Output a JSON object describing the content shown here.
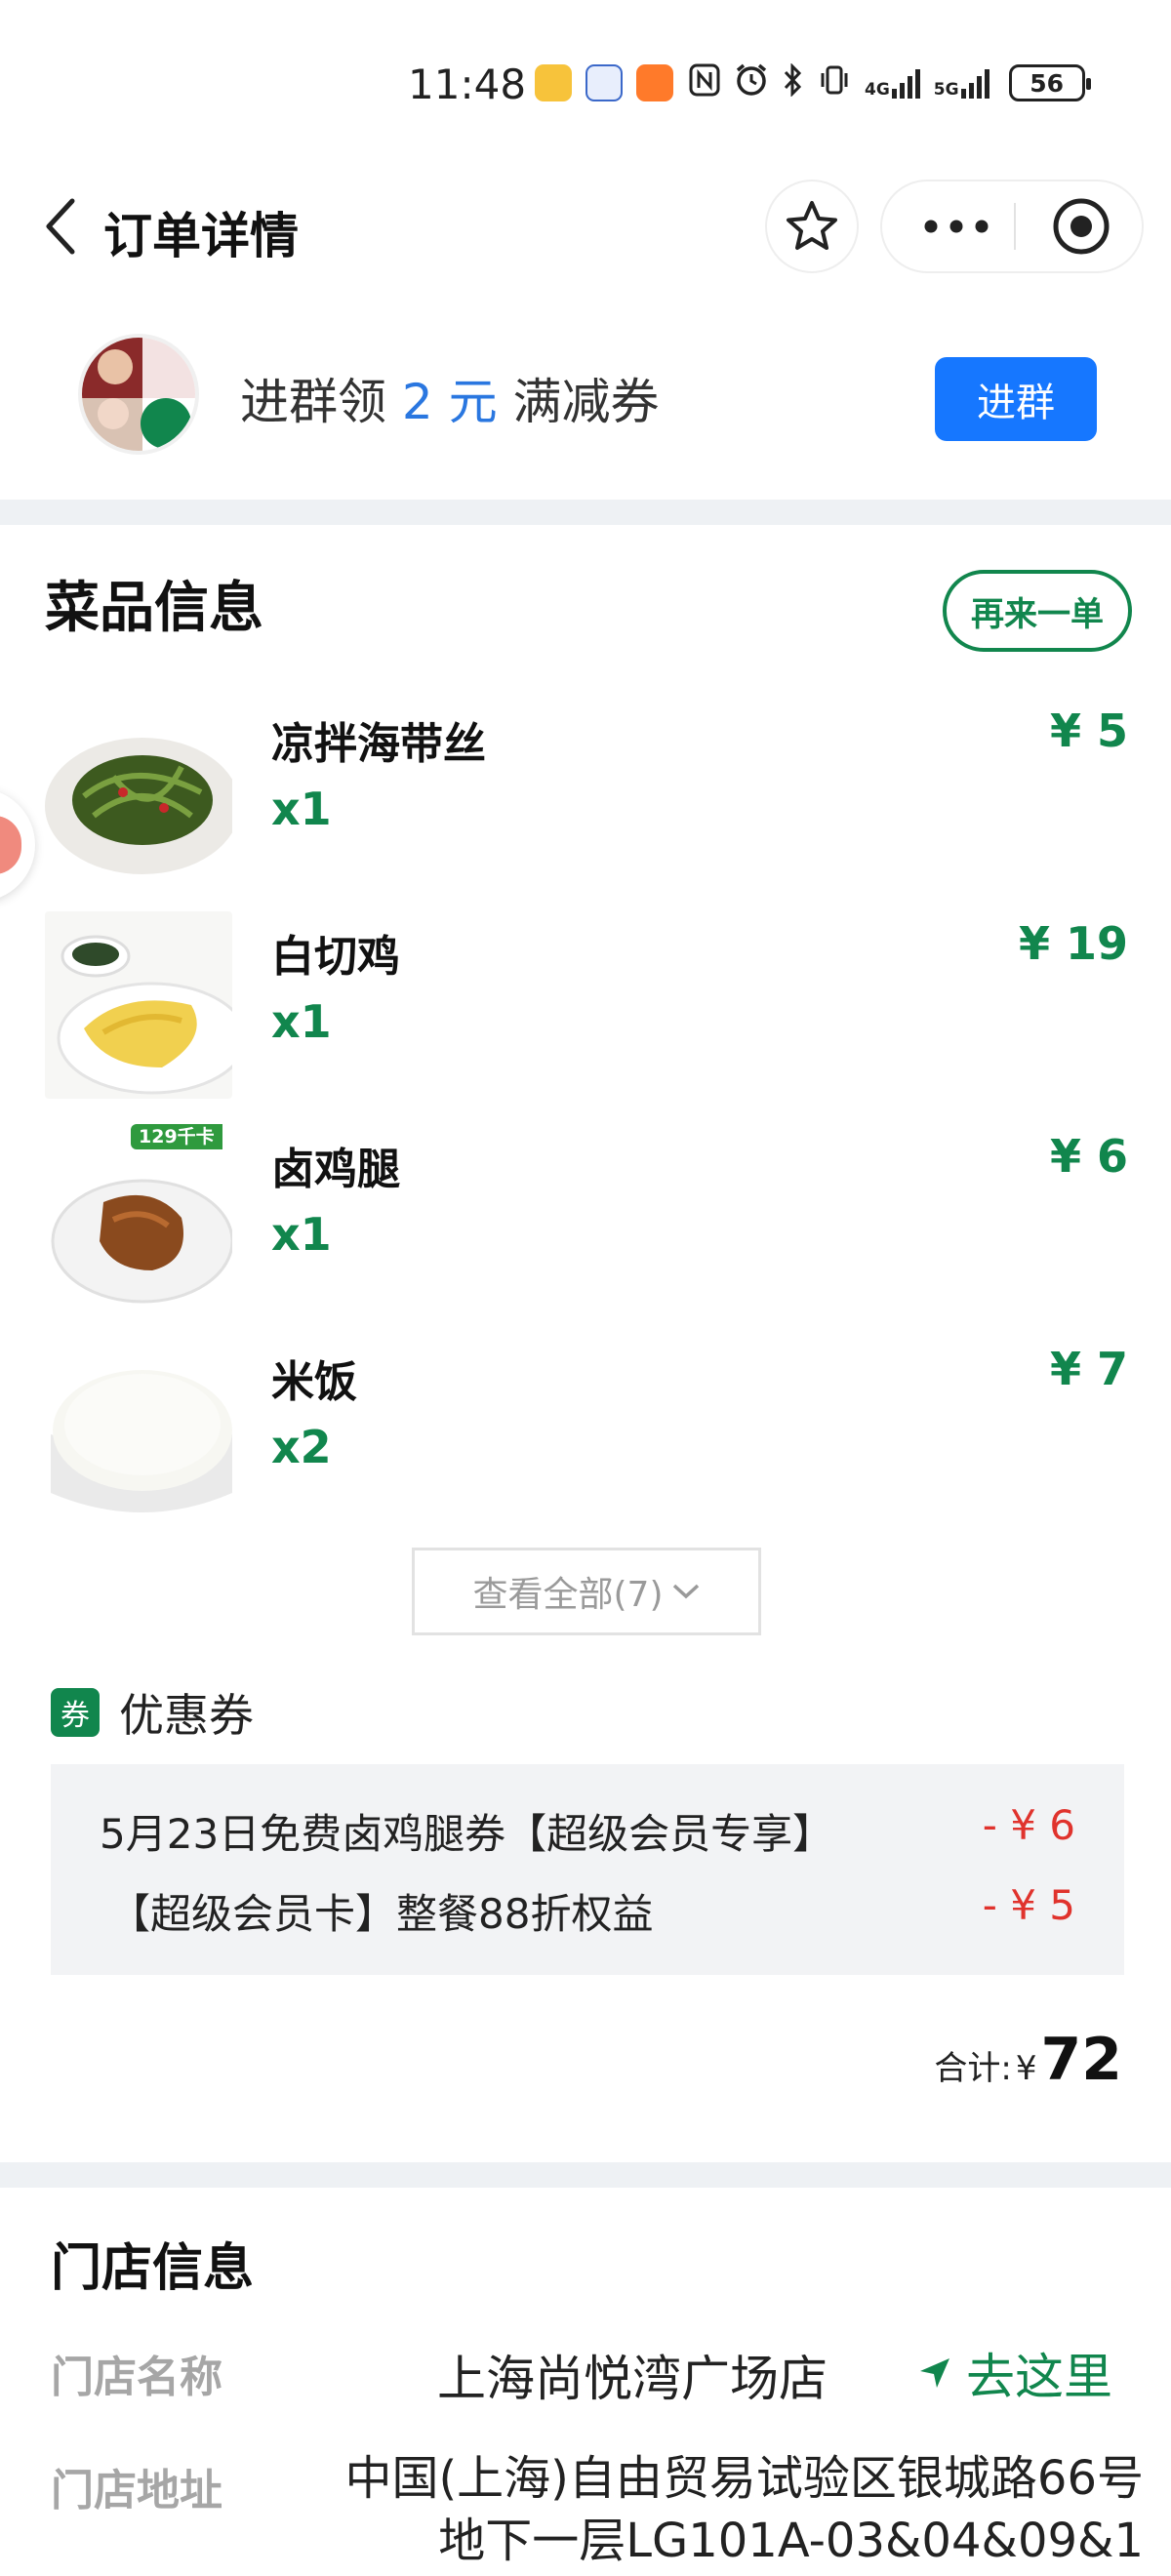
{
  "status_bar": {
    "time": "11:48",
    "network_4g": "4G",
    "network_5g": "5G",
    "battery": "56"
  },
  "nav": {
    "title": "订单详情"
  },
  "group": {
    "text_before": "进群领",
    "amount": "2 元",
    "text_after": "满减券",
    "join_label": "进群"
  },
  "dishes": {
    "header": "菜品信息",
    "reorder_label": "再来一单",
    "items": [
      {
        "name": "凉拌海带丝",
        "qty": "x1",
        "price": "¥ 5"
      },
      {
        "name": "白切鸡",
        "qty": "x1",
        "price": "¥ 19"
      },
      {
        "name": "卤鸡腿",
        "qty": "x1",
        "price": "¥ 6",
        "tag": "129千卡"
      },
      {
        "name": "米饭",
        "qty": "x2",
        "price": "¥ 7"
      }
    ],
    "view_all": "查看全部(7)"
  },
  "coupons": {
    "badge": "券",
    "label": "优惠券",
    "items": [
      {
        "name": "5月23日免费卤鸡腿券【超级会员专享】",
        "amount": "- ¥ 6"
      },
      {
        "name": "【超级会员卡】整餐88折权益",
        "amount": "- ¥ 5"
      }
    ]
  },
  "total": {
    "label": "合计:",
    "currency": "¥",
    "value": "72"
  },
  "store": {
    "title": "门店信息",
    "name_key": "门店名称",
    "name": "上海尚悦湾广场店",
    "nav_label": "去这里",
    "addr_key": "门店地址",
    "address": "中国(上海)自由贸易试验区银城路66号地下一层LG101A-03&04&09&1"
  },
  "colors": {
    "brand_green": "#11864d",
    "join_blue": "#1677ff",
    "discount_red": "#e0332d"
  }
}
